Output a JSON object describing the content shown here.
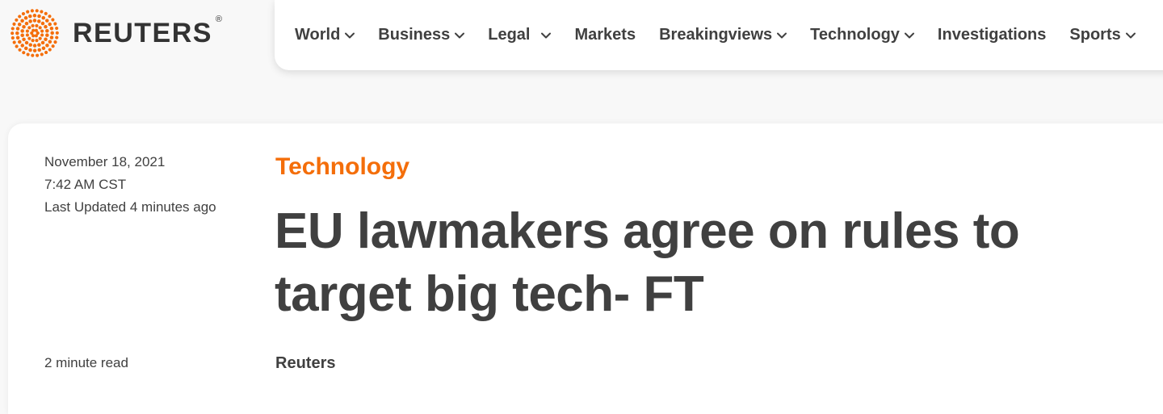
{
  "header": {
    "logo": {
      "wordmark": "REUTERS",
      "registered": "®",
      "icon": "reuters-dot-logo-icon",
      "brand_color": "#f46e0a"
    },
    "nav": [
      {
        "label": "World",
        "dropdown": true
      },
      {
        "label": "Business",
        "dropdown": true
      },
      {
        "label": "Legal",
        "dropdown": true
      },
      {
        "label": "Markets",
        "dropdown": false
      },
      {
        "label": "Breakingviews",
        "dropdown": true
      },
      {
        "label": "Technology",
        "dropdown": true
      },
      {
        "label": "Investigations",
        "dropdown": false
      },
      {
        "label": "Sports",
        "dropdown": true
      }
    ]
  },
  "article": {
    "date": "November 18, 2021",
    "time": "7:42 AM CST",
    "updated": "Last Updated 4 minutes ago",
    "read_time": "2 minute read",
    "category": "Technology",
    "category_color": "#f46e0a",
    "headline": "EU lawmakers agree on rules to target big tech- FT",
    "byline": "Reuters"
  }
}
